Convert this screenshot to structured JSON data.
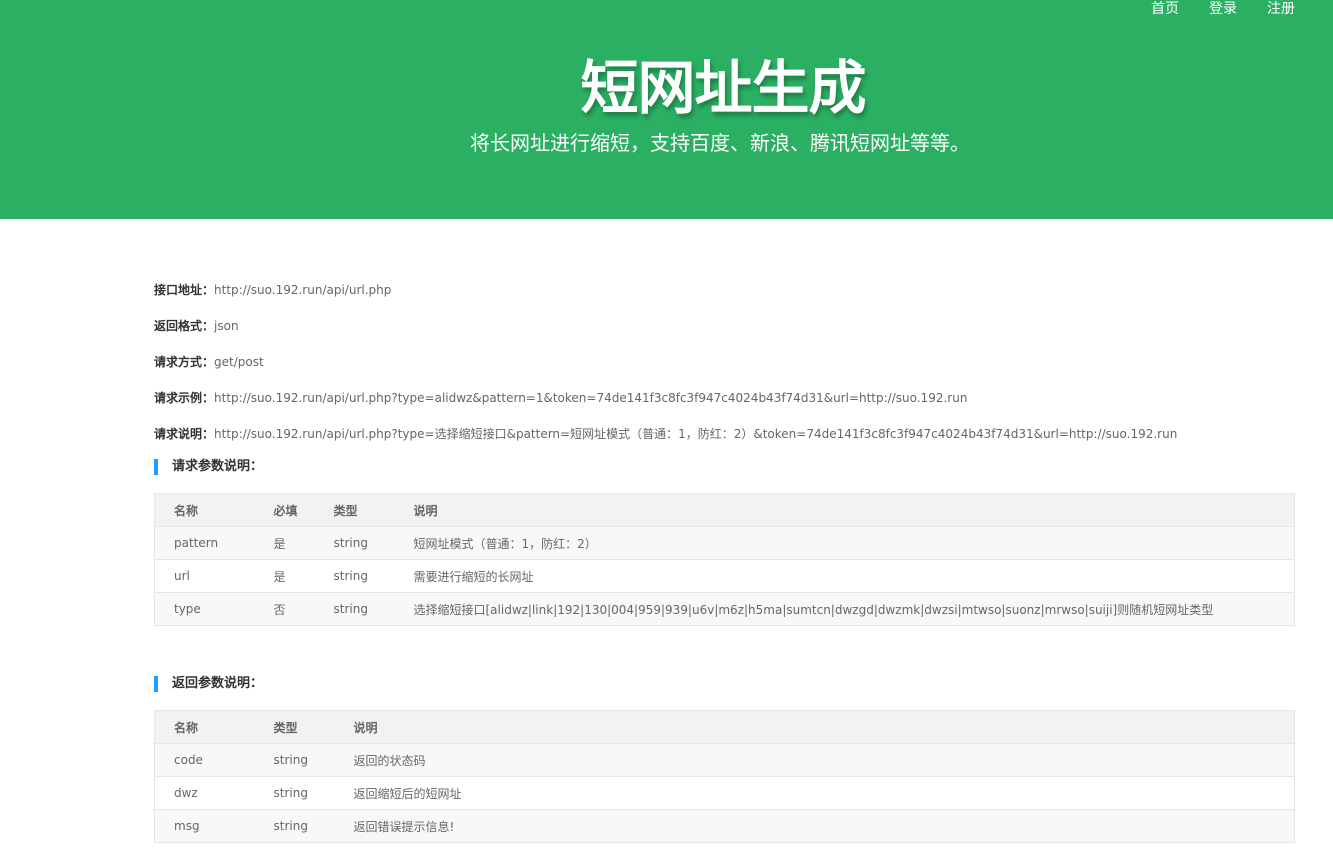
{
  "nav": {
    "home": "首页",
    "login": "登录",
    "register": "注册"
  },
  "hero": {
    "title": "短网址生成",
    "subtitle": "将长网址进行缩短，支持百度、新浪、腾讯短网址等等。"
  },
  "api_info": [
    {
      "label": "接口地址：",
      "value": "http://suo.192.run/api/url.php"
    },
    {
      "label": "返回格式：",
      "value": "json"
    },
    {
      "label": "请求方式：",
      "value": "get/post"
    },
    {
      "label": "请求示例：",
      "value": "http://suo.192.run/api/url.php?type=alidwz&pattern=1&token=74de141f3c8fc3f947c4024b43f74d31&url=http://suo.192.run"
    },
    {
      "label": "请求说明：",
      "value": "http://suo.192.run/api/url.php?type=选择缩短接口&pattern=短网址模式（普通：1，防红：2）&token=74de141f3c8fc3f947c4024b43f74d31&url=http://suo.192.run"
    }
  ],
  "request_params": {
    "title": "请求参数说明：",
    "headers": [
      "名称",
      "必填",
      "类型",
      "说明"
    ],
    "rows": [
      [
        "pattern",
        "是",
        "string",
        "短网址模式（普通：1，防红：2）"
      ],
      [
        "url",
        "是",
        "string",
        "需要进行缩短的长网址"
      ],
      [
        "type",
        "否",
        "string",
        "选择缩短接口[alidwz|link|192|130|004|959|939|u6v|m6z|h5ma|sumtcn|dwzgd|dwzmk|dwzsi|mtwso|suonz|mrwso|suiji]则随机短网址类型"
      ]
    ]
  },
  "response_params": {
    "title": "返回参数说明：",
    "headers": [
      "名称",
      "类型",
      "说明"
    ],
    "rows": [
      [
        "code",
        "string",
        "返回的状态码"
      ],
      [
        "dwz",
        "string",
        "返回缩短后的短网址"
      ],
      [
        "msg",
        "string",
        "返回错误提示信息!"
      ]
    ]
  },
  "colors": {
    "hero_bg": "#2bb063",
    "accent_bar": "#1e9fff"
  }
}
